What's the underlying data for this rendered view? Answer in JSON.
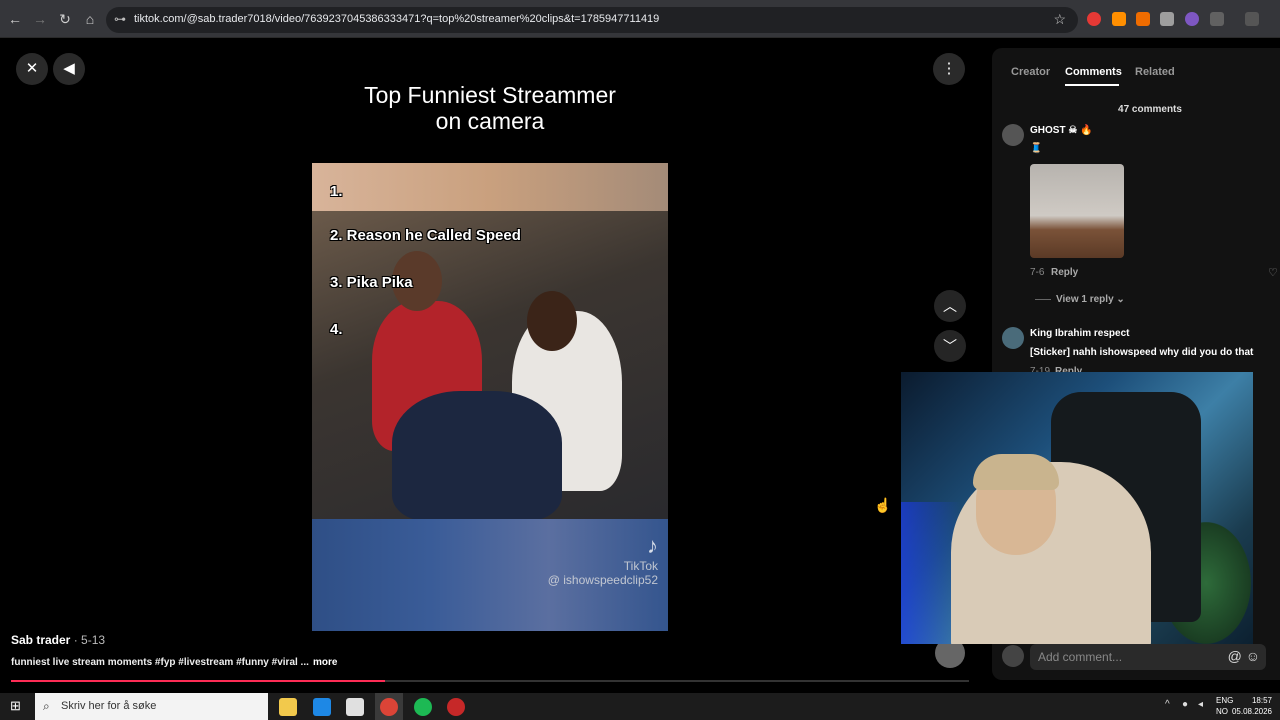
{
  "browser": {
    "url": "tiktok.com/@sab.trader7018/video/7639237045386333471?q=top%20streamer%20clips&t=1785947711419",
    "back_icon": "arrow-left-icon",
    "forward_icon": "arrow-right-icon",
    "reload_icon": "reload-icon",
    "home_icon": "home-icon"
  },
  "video": {
    "title_line1": "Top Funniest Streammer",
    "title_line2": "on camera",
    "list": [
      "1.",
      "2. Reason he Called Speed",
      "3. Pika Pika",
      "4."
    ],
    "watermark_brand": "TikTok",
    "watermark_handle": "@ ishowspeedclip52",
    "creator": "Sab trader",
    "date": " · 5-13",
    "caption": "funniest live stream moments #fyp #livestream #funny #viral ...",
    "more_label": "more",
    "progress": 0.39
  },
  "panel": {
    "tabs": [
      "Creator",
      "Comments",
      "Related"
    ],
    "active_tab": "Comments",
    "comment_count": "47 comments",
    "comments": [
      {
        "name": "GHOST ☠ 🔥",
        "text": "🧵",
        "date": "7-6",
        "reply": "Reply",
        "view_replies": "View 1 reply"
      },
      {
        "name": "King Ibrahim respect",
        "text": "[Sticker] nahh ishowspeed why did you do that",
        "date": "7-19",
        "reply": "Reply"
      }
    ],
    "add_comment_placeholder": "Add comment..."
  },
  "taskbar": {
    "search_placeholder": "Skriv her for å søke",
    "lang1": "ENG",
    "lang2": "NO",
    "time": "18:57",
    "date": "05.08.2026"
  }
}
